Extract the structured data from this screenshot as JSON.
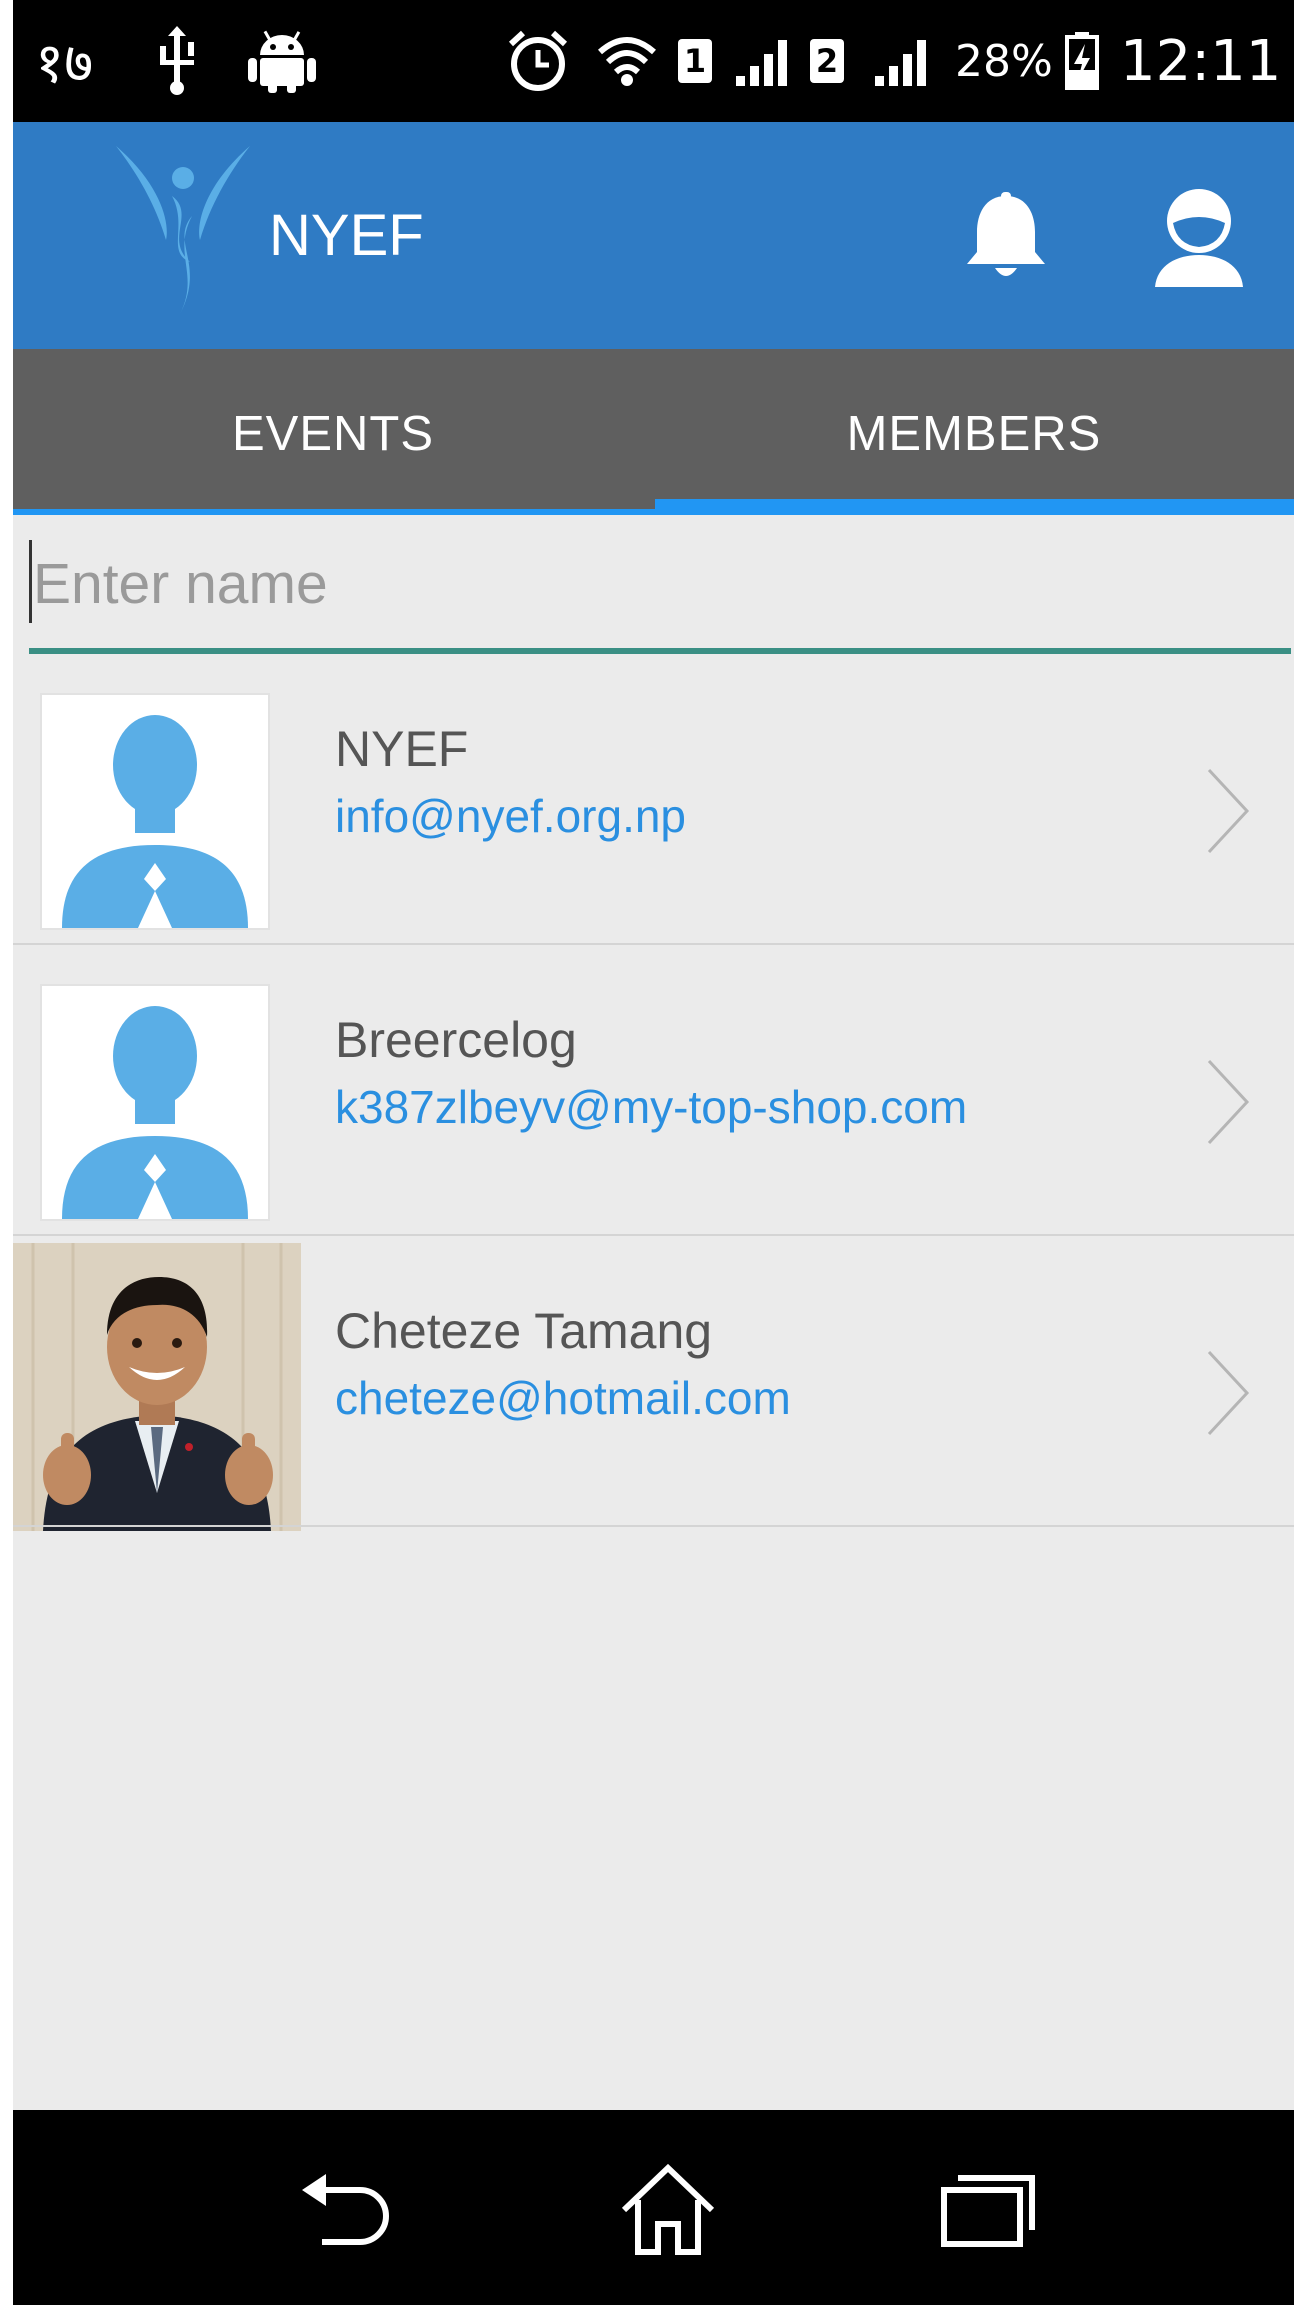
{
  "status_bar": {
    "left_text": "१७",
    "sim1": "1",
    "sim2": "2",
    "battery_percent": "28%",
    "time": "12:11"
  },
  "app_bar": {
    "title": "NYEF",
    "logo_icon": "nyef-logo",
    "notification_icon": "bell-icon",
    "profile_icon": "user-icon"
  },
  "tabs": [
    {
      "label": "EVENTS",
      "selected": false
    },
    {
      "label": "MEMBERS",
      "selected": true
    }
  ],
  "search": {
    "placeholder": "Enter name",
    "value": ""
  },
  "members": [
    {
      "name": "NYEF",
      "email": "info@nyef.org.np",
      "avatar": "placeholder-avatar"
    },
    {
      "name": "Breercelog",
      "email": "k387zlbeyv@my-top-shop.com",
      "avatar": "placeholder-avatar"
    },
    {
      "name": "Cheteze Tamang",
      "email": "cheteze@hotmail.com",
      "avatar": "photo"
    }
  ],
  "nav_bar": {
    "back_icon": "back-icon",
    "home_icon": "home-icon",
    "recents_icon": "recent-apps-icon"
  },
  "colors": {
    "app_bar": "#2f7bc4",
    "tab_bar": "#5f5f5f",
    "accent": "#2196f3",
    "email_link": "#2a8fe0",
    "search_underline": "#3a8f84",
    "background": "#ebebeb"
  }
}
